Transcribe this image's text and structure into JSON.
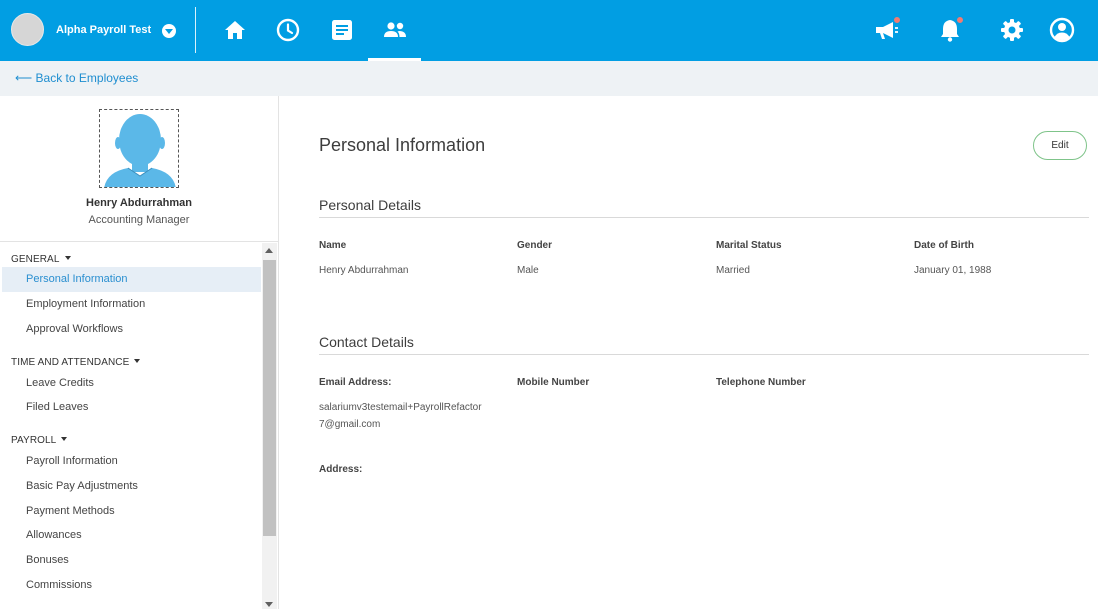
{
  "header": {
    "company_name": "Alpha Payroll Test",
    "nav": [
      {
        "name": "home-icon"
      },
      {
        "name": "clock-icon"
      },
      {
        "name": "document-icon"
      },
      {
        "name": "people-icon",
        "active": true
      }
    ],
    "right_icons": [
      "megaphone-icon",
      "bell-icon",
      "gear-icon",
      "user-circle-icon"
    ],
    "accent_color": "#019ee3",
    "notification_dot_color": "#f27b72"
  },
  "back_link": "⟵ Back to Employees",
  "employee": {
    "name": "Henry Abdurrahman",
    "title": "Accounting Manager"
  },
  "sidebar": {
    "sections": [
      {
        "label": "GENERAL",
        "items": [
          "Personal Information",
          "Employment Information",
          "Approval Workflows"
        ]
      },
      {
        "label": "TIME AND ATTENDANCE",
        "items": [
          "Leave Credits",
          "Filed Leaves"
        ]
      },
      {
        "label": "PAYROLL",
        "items": [
          "Payroll Information",
          "Basic Pay Adjustments",
          "Payment Methods",
          "Allowances",
          "Bonuses",
          "Commissions"
        ]
      }
    ],
    "active_item": "Personal Information"
  },
  "main": {
    "page_title": "Personal Information",
    "edit_label": "Edit",
    "personal_details": {
      "title": "Personal Details",
      "fields": [
        {
          "label": "Name",
          "value": "Henry Abdurrahman"
        },
        {
          "label": "Gender",
          "value": "Male"
        },
        {
          "label": "Marital Status",
          "value": "Married"
        },
        {
          "label": "Date of Birth",
          "value": "January 01, 1988"
        }
      ]
    },
    "contact_details": {
      "title": "Contact Details",
      "email_label": "Email Address:",
      "email_line1": "salariumv3testemail+PayrollRefactor",
      "email_line2": "7@gmail.com",
      "mobile_label": "Mobile Number",
      "telephone_label": "Telephone Number",
      "address_label": "Address:"
    }
  }
}
